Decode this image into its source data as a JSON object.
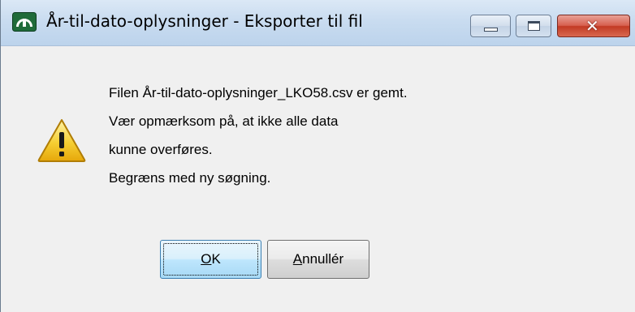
{
  "window": {
    "title": "År-til-dato-oplysninger - Eksporter til fil",
    "app_icon": "app-logo-icon",
    "caption_buttons": {
      "minimize_icon": "minimize-icon",
      "maximize_icon": "maximize-icon",
      "close_icon": "close-icon",
      "close_glyph": "✕"
    },
    "colors": {
      "titlebar": "#c9dcf0",
      "close_button": "#c94a35",
      "dialog_body": "#f0f0f0"
    }
  },
  "dialog": {
    "icon": "warning-icon",
    "message_lines": [
      "Filen År-til-dato-oplysninger_LKO58.csv er gemt.",
      "Vær opmærksom på, at ikke alle data",
      "kunne overføres.",
      "Begræns med ny søgning."
    ],
    "buttons": {
      "ok": {
        "mnemonic": "O",
        "rest": "K"
      },
      "cancel": {
        "mnemonic": "A",
        "rest": "nnullér"
      }
    }
  }
}
